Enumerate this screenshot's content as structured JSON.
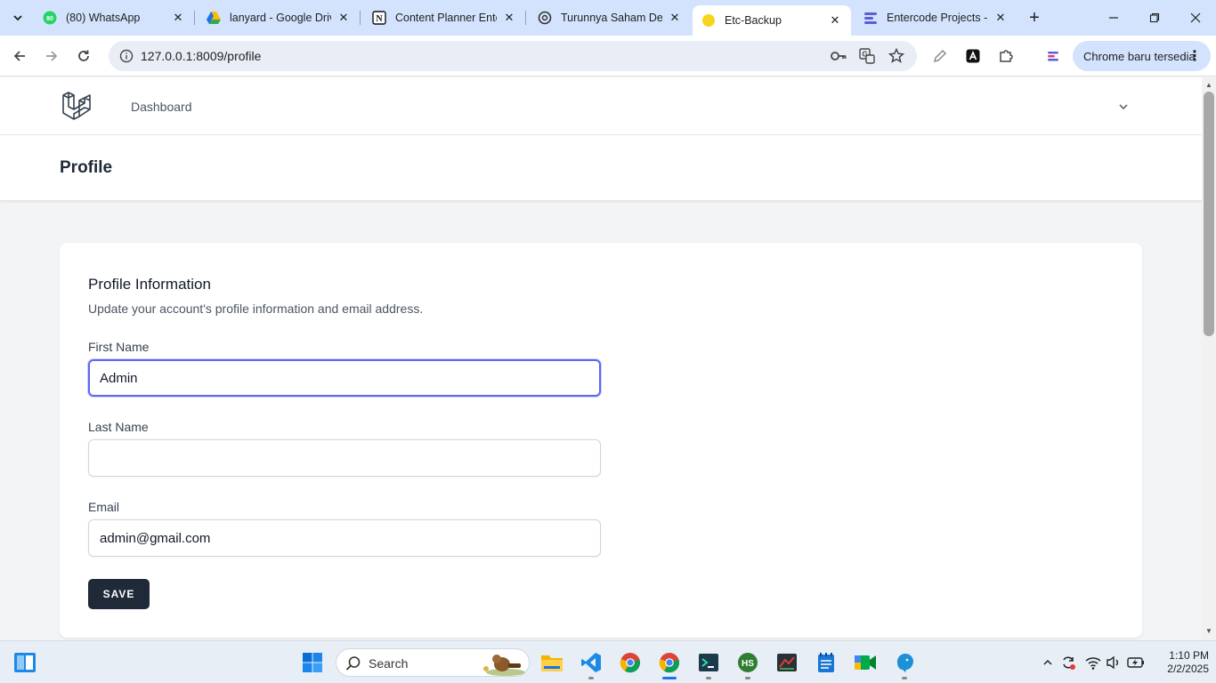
{
  "browser": {
    "tabs": [
      {
        "title": "(80) WhatsApp",
        "badge": "80",
        "icon": "whatsapp-icon"
      },
      {
        "title": "lanyard - Google Drive",
        "icon": "google-drive-icon"
      },
      {
        "title": "Content Planner Entercode",
        "icon": "notion-icon"
      },
      {
        "title": "Turunnya Saham Deepseek",
        "icon": "openai-icon"
      },
      {
        "title": "Etc-Backup",
        "icon": "yellow-dot-icon",
        "active": true
      },
      {
        "title": "Entercode Projects - Shared",
        "icon": "clickup-icon"
      }
    ],
    "url": "127.0.0.1:8009/profile",
    "update_label": "Chrome baru tersedia"
  },
  "nav": {
    "dashboard_label": "Dashboard"
  },
  "header": {
    "title": "Profile"
  },
  "form": {
    "title": "Profile Information",
    "description": "Update your account's profile information and email address.",
    "first_name_label": "First Name",
    "first_name_value": "Admin",
    "last_name_label": "Last Name",
    "last_name_value": "",
    "email_label": "Email",
    "email_value": "admin@gmail.com",
    "save_label": "SAVE"
  },
  "taskbar": {
    "search_label": "Search",
    "time": "1:10 PM",
    "date": "2/2/2025"
  },
  "colors": {
    "accent": "#6366f1",
    "button": "#1f2937",
    "tabstrip": "#d3e3fd"
  }
}
